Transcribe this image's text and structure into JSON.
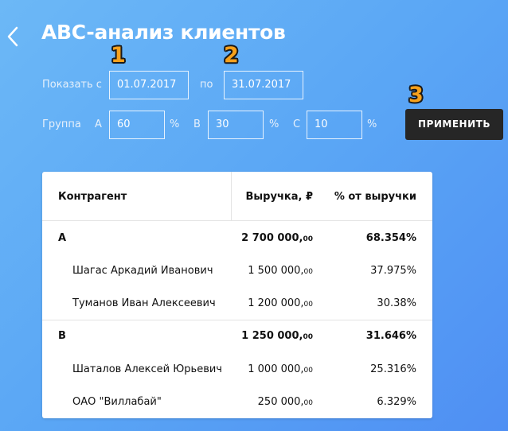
{
  "header": {
    "title": "ABC-анализ клиентов"
  },
  "steps": [
    "1",
    "2",
    "3"
  ],
  "filters": {
    "show_label": "Показать с",
    "date_from": "01.07.2017",
    "to_label": "по",
    "date_to": "31.07.2017",
    "group_label": "Группа",
    "groups": [
      {
        "name": "A",
        "value": "60",
        "unit": "%"
      },
      {
        "name": "B",
        "value": "30",
        "unit": "%"
      },
      {
        "name": "C",
        "value": "10",
        "unit": "%"
      }
    ],
    "apply_label": "ПРИМЕНИТЬ"
  },
  "table": {
    "columns": [
      "Контрагент",
      "Выручка, ₽",
      "% от выручки"
    ],
    "rows": [
      {
        "name": "A",
        "revenue_int": "2 700 000,",
        "revenue_dec": "00",
        "percent": "68.354%",
        "group": true
      },
      {
        "name": "Шагас Аркадий Иванович",
        "revenue_int": "1 500 000,",
        "revenue_dec": "00",
        "percent": "37.975%",
        "group": false
      },
      {
        "name": "Туманов Иван Алексеевич",
        "revenue_int": "1 200 000,",
        "revenue_dec": "00",
        "percent": "30.38%",
        "group": false
      },
      {
        "name": "B",
        "revenue_int": "1 250 000,",
        "revenue_dec": "00",
        "percent": "31.646%",
        "group": true
      },
      {
        "name": "Шаталов Алексей Юрьевич",
        "revenue_int": "1 000 000,",
        "revenue_dec": "00",
        "percent": "25.316%",
        "group": false
      },
      {
        "name": "ОАО \"Виллабай\"",
        "revenue_int": "250 000,",
        "revenue_dec": "00",
        "percent": "6.329%",
        "group": false
      }
    ]
  }
}
